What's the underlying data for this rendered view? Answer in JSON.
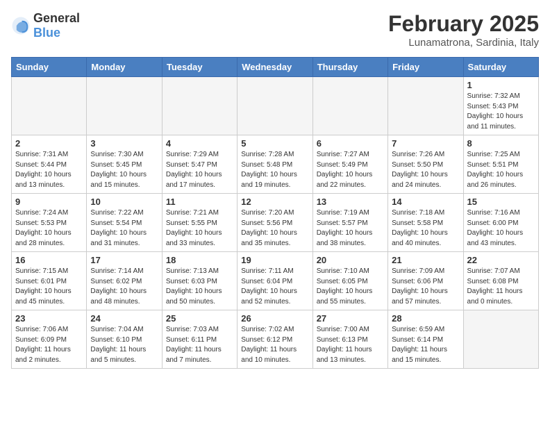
{
  "header": {
    "logo_general": "General",
    "logo_blue": "Blue",
    "month_year": "February 2025",
    "location": "Lunamatrona, Sardinia, Italy"
  },
  "weekdays": [
    "Sunday",
    "Monday",
    "Tuesday",
    "Wednesday",
    "Thursday",
    "Friday",
    "Saturday"
  ],
  "weeks": [
    [
      {
        "day": "",
        "info": ""
      },
      {
        "day": "",
        "info": ""
      },
      {
        "day": "",
        "info": ""
      },
      {
        "day": "",
        "info": ""
      },
      {
        "day": "",
        "info": ""
      },
      {
        "day": "",
        "info": ""
      },
      {
        "day": "1",
        "info": "Sunrise: 7:32 AM\nSunset: 5:43 PM\nDaylight: 10 hours\nand 11 minutes."
      }
    ],
    [
      {
        "day": "2",
        "info": "Sunrise: 7:31 AM\nSunset: 5:44 PM\nDaylight: 10 hours\nand 13 minutes."
      },
      {
        "day": "3",
        "info": "Sunrise: 7:30 AM\nSunset: 5:45 PM\nDaylight: 10 hours\nand 15 minutes."
      },
      {
        "day": "4",
        "info": "Sunrise: 7:29 AM\nSunset: 5:47 PM\nDaylight: 10 hours\nand 17 minutes."
      },
      {
        "day": "5",
        "info": "Sunrise: 7:28 AM\nSunset: 5:48 PM\nDaylight: 10 hours\nand 19 minutes."
      },
      {
        "day": "6",
        "info": "Sunrise: 7:27 AM\nSunset: 5:49 PM\nDaylight: 10 hours\nand 22 minutes."
      },
      {
        "day": "7",
        "info": "Sunrise: 7:26 AM\nSunset: 5:50 PM\nDaylight: 10 hours\nand 24 minutes."
      },
      {
        "day": "8",
        "info": "Sunrise: 7:25 AM\nSunset: 5:51 PM\nDaylight: 10 hours\nand 26 minutes."
      }
    ],
    [
      {
        "day": "9",
        "info": "Sunrise: 7:24 AM\nSunset: 5:53 PM\nDaylight: 10 hours\nand 28 minutes."
      },
      {
        "day": "10",
        "info": "Sunrise: 7:22 AM\nSunset: 5:54 PM\nDaylight: 10 hours\nand 31 minutes."
      },
      {
        "day": "11",
        "info": "Sunrise: 7:21 AM\nSunset: 5:55 PM\nDaylight: 10 hours\nand 33 minutes."
      },
      {
        "day": "12",
        "info": "Sunrise: 7:20 AM\nSunset: 5:56 PM\nDaylight: 10 hours\nand 35 minutes."
      },
      {
        "day": "13",
        "info": "Sunrise: 7:19 AM\nSunset: 5:57 PM\nDaylight: 10 hours\nand 38 minutes."
      },
      {
        "day": "14",
        "info": "Sunrise: 7:18 AM\nSunset: 5:58 PM\nDaylight: 10 hours\nand 40 minutes."
      },
      {
        "day": "15",
        "info": "Sunrise: 7:16 AM\nSunset: 6:00 PM\nDaylight: 10 hours\nand 43 minutes."
      }
    ],
    [
      {
        "day": "16",
        "info": "Sunrise: 7:15 AM\nSunset: 6:01 PM\nDaylight: 10 hours\nand 45 minutes."
      },
      {
        "day": "17",
        "info": "Sunrise: 7:14 AM\nSunset: 6:02 PM\nDaylight: 10 hours\nand 48 minutes."
      },
      {
        "day": "18",
        "info": "Sunrise: 7:13 AM\nSunset: 6:03 PM\nDaylight: 10 hours\nand 50 minutes."
      },
      {
        "day": "19",
        "info": "Sunrise: 7:11 AM\nSunset: 6:04 PM\nDaylight: 10 hours\nand 52 minutes."
      },
      {
        "day": "20",
        "info": "Sunrise: 7:10 AM\nSunset: 6:05 PM\nDaylight: 10 hours\nand 55 minutes."
      },
      {
        "day": "21",
        "info": "Sunrise: 7:09 AM\nSunset: 6:06 PM\nDaylight: 10 hours\nand 57 minutes."
      },
      {
        "day": "22",
        "info": "Sunrise: 7:07 AM\nSunset: 6:08 PM\nDaylight: 11 hours\nand 0 minutes."
      }
    ],
    [
      {
        "day": "23",
        "info": "Sunrise: 7:06 AM\nSunset: 6:09 PM\nDaylight: 11 hours\nand 2 minutes."
      },
      {
        "day": "24",
        "info": "Sunrise: 7:04 AM\nSunset: 6:10 PM\nDaylight: 11 hours\nand 5 minutes."
      },
      {
        "day": "25",
        "info": "Sunrise: 7:03 AM\nSunset: 6:11 PM\nDaylight: 11 hours\nand 7 minutes."
      },
      {
        "day": "26",
        "info": "Sunrise: 7:02 AM\nSunset: 6:12 PM\nDaylight: 11 hours\nand 10 minutes."
      },
      {
        "day": "27",
        "info": "Sunrise: 7:00 AM\nSunset: 6:13 PM\nDaylight: 11 hours\nand 13 minutes."
      },
      {
        "day": "28",
        "info": "Sunrise: 6:59 AM\nSunset: 6:14 PM\nDaylight: 11 hours\nand 15 minutes."
      },
      {
        "day": "",
        "info": ""
      }
    ]
  ]
}
